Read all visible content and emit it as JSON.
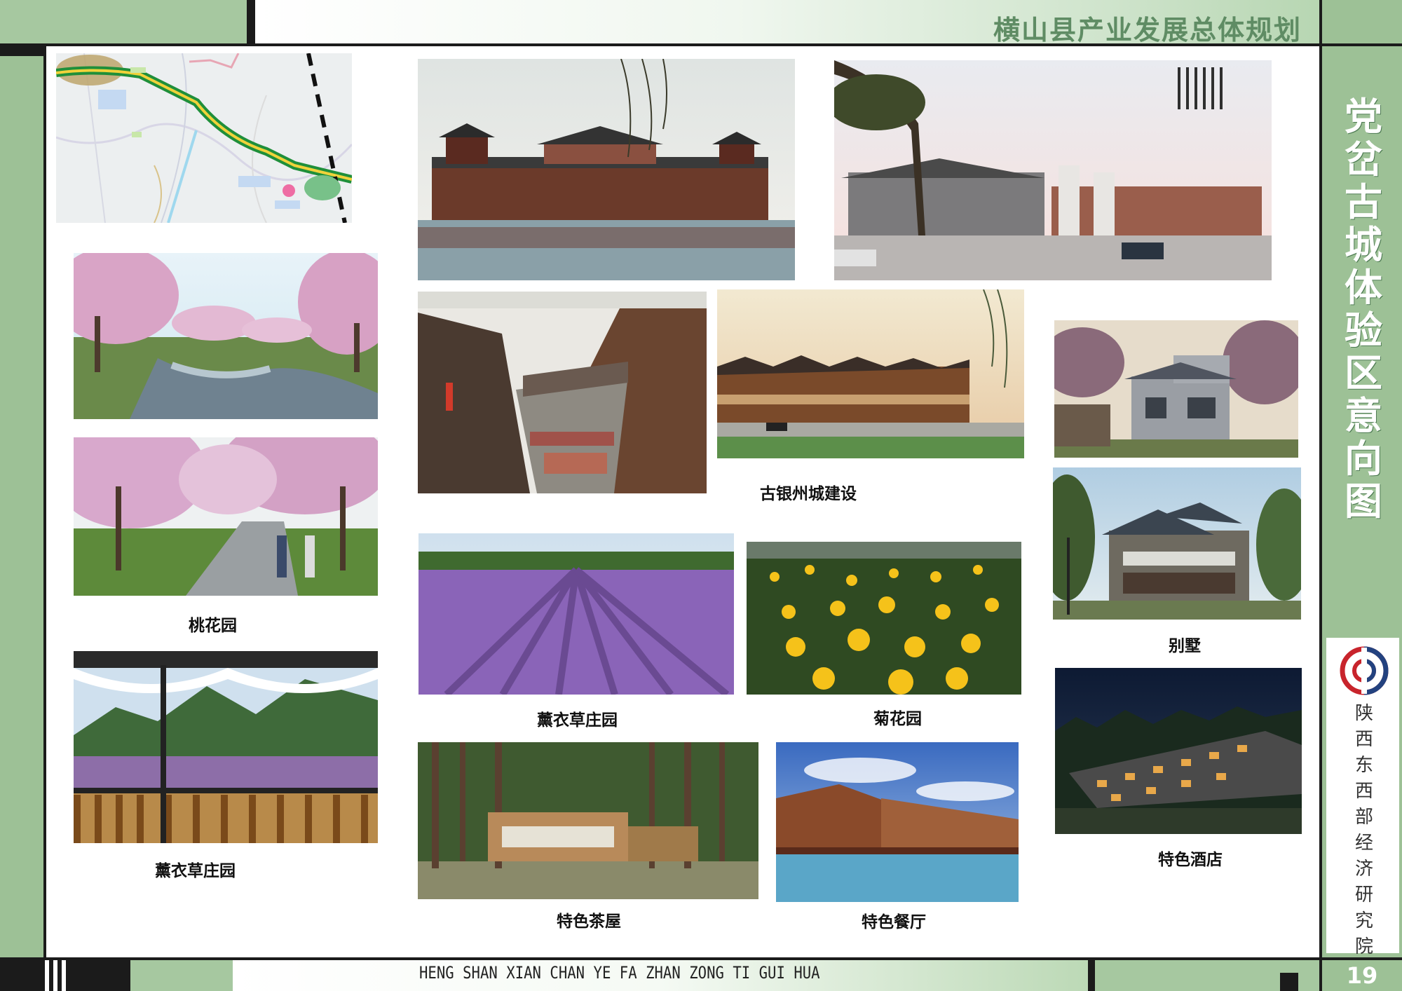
{
  "header": {
    "title": "横山县产业发展总体规划"
  },
  "sidebar": {
    "title": "党岔古城体验区意向图",
    "organization": "陕西东西部经济研究院"
  },
  "footer": {
    "pinyin": "HENG SHAN XIAN CHAN YE FA ZHAN ZONG TI GUI HUA",
    "page_number": "19"
  },
  "captions": {
    "guyinzhou": "古银州城建设",
    "peach_garden": "桃花园",
    "lavender_1": "薰衣草庄园",
    "lavender_2": "薰衣草庄园",
    "chrysanthemum": "菊花园",
    "villa": "别墅",
    "hotel": "特色酒店",
    "teahouse": "特色茶屋",
    "restaurant": "特色餐厅"
  },
  "colors": {
    "frame_green": "#9dc196",
    "title_green": "#5f8c64",
    "frame_black": "#1b1b1b"
  },
  "icons": {
    "logo": "institute-logo"
  }
}
